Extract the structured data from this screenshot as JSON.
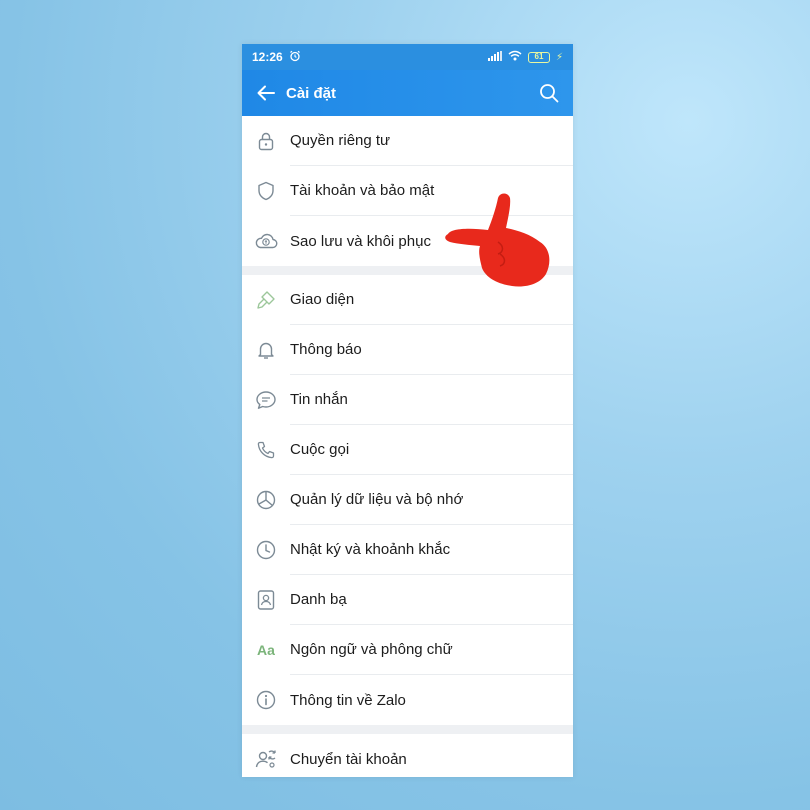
{
  "status_bar": {
    "time": "12:26",
    "battery": "61"
  },
  "app_bar": {
    "title": "Cài đặt"
  },
  "settings": {
    "group1": [
      {
        "label": "Quyền riêng tư",
        "icon": "lock-icon"
      },
      {
        "label": "Tài khoản và bảo mật",
        "icon": "shield-icon"
      },
      {
        "label": "Sao lưu và khôi phục",
        "icon": "cloud-backup-icon"
      }
    ],
    "group2": [
      {
        "label": "Giao diện",
        "icon": "paint-brush-icon"
      },
      {
        "label": "Thông báo",
        "icon": "bell-icon"
      },
      {
        "label": "Tin nhắn",
        "icon": "chat-bubble-icon"
      },
      {
        "label": "Cuộc gọi",
        "icon": "phone-icon"
      },
      {
        "label": "Quản lý dữ liệu và bộ nhớ",
        "icon": "pie-chart-icon"
      },
      {
        "label": "Nhật ký và khoảnh khắc",
        "icon": "clock-icon"
      },
      {
        "label": "Danh bạ",
        "icon": "contact-card-icon"
      },
      {
        "label": "Ngôn ngữ và phông chữ",
        "icon": "font-aa-icon",
        "icon_text": "Aa"
      },
      {
        "label": "Thông tin về Zalo",
        "icon": "info-icon"
      }
    ],
    "group3": [
      {
        "label": "Chuyển tài khoản",
        "icon": "switch-account-icon"
      }
    ]
  },
  "colors": {
    "app_bar": "#1f88e6",
    "icon": "#7c8a95",
    "pointer": "#e8291c"
  }
}
